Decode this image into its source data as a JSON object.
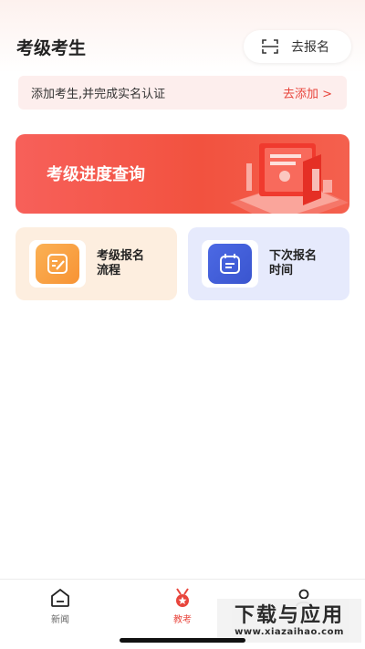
{
  "header": {
    "title": "考级考生",
    "register_button": {
      "label": "去报名",
      "icon": "scan-icon"
    }
  },
  "notice": {
    "text": "添加考生,并完成实名认证",
    "link": "去添加 >"
  },
  "progress_banner": {
    "label": "考级进度查询"
  },
  "cards": [
    {
      "title": "考级报名流程",
      "icon": "edit-form-icon",
      "color": "#f79334"
    },
    {
      "title": "下次报名时间",
      "icon": "calendar-icon",
      "color": "#3a55cf"
    }
  ],
  "tabbar": {
    "items": [
      {
        "label": "新闻",
        "icon": "home-icon",
        "active": false
      },
      {
        "label": "教考",
        "icon": "medal-icon",
        "active": true
      },
      {
        "label": "",
        "icon": "person-icon",
        "active": false
      }
    ]
  },
  "watermark": {
    "main": "下载与应用",
    "sub": "www.xiazaihao.com"
  },
  "colors": {
    "accent": "#e8453c",
    "notice_bg": "#fdeeed"
  }
}
